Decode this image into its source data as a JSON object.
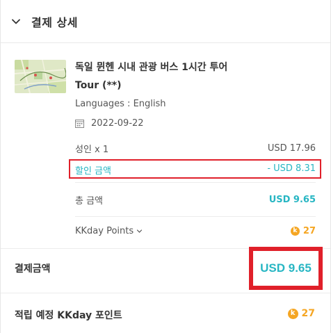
{
  "header": {
    "title": "결제 상세"
  },
  "product": {
    "title": "독일 뮌헨 시내 관광 버스 1시간 투어",
    "subtitle": "Tour (**)",
    "languages": "Languages : English",
    "date": "2022-09-22"
  },
  "price_rows": {
    "adult": {
      "label": "성인 x 1",
      "value": "USD 17.96"
    },
    "discount": {
      "label": "할인 금액",
      "value": "- USD 8.31"
    },
    "total": {
      "label": "총 금액",
      "value": "USD 9.65"
    },
    "points": {
      "label": "KKday Points",
      "coin": "k",
      "value": "27"
    }
  },
  "payment": {
    "label": "결제금액",
    "amount": "USD 9.65"
  },
  "earn": {
    "label": "적립 예정 KKday 포인트",
    "coin": "k",
    "value": "27"
  },
  "colors": {
    "accent": "#27b6c3",
    "highlight": "#e0202a",
    "points": "#f5a623"
  }
}
